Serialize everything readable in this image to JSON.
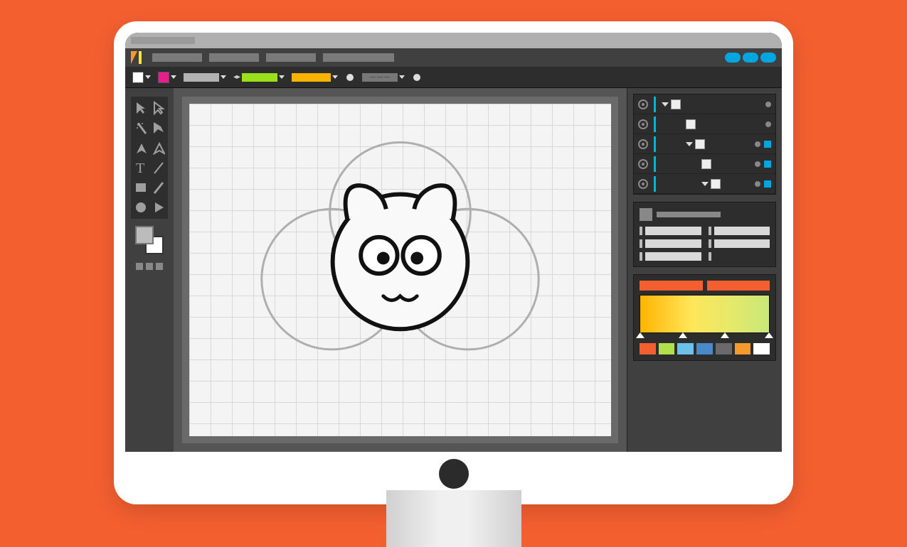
{
  "app": {
    "logo_colors": {
      "left": "#f79a2e",
      "right": "#ffe23a"
    }
  },
  "title_bar": {
    "placeholder_widths": [
      90
    ]
  },
  "menu_bar": {
    "item_widths": [
      70,
      70,
      70,
      100
    ],
    "window_button_color": "#00a6e0"
  },
  "options_bar": {
    "fill_color": "#ffffff",
    "stroke_color": "#ec1b8d",
    "stroke_weight_bar_color": "#b2b2b2",
    "swatch_a_color": "#9be01c",
    "swatch_b_color": "#f8b200"
  },
  "tools": [
    [
      "selection",
      "direct-selection"
    ],
    [
      "magic-wand",
      "lasso"
    ],
    [
      "pen",
      "curvature-pen"
    ],
    [
      "type",
      "line"
    ],
    [
      "rectangle",
      "pencil"
    ],
    [
      "ellipse",
      "play"
    ]
  ],
  "color_swatches": {
    "foreground": "#bcbcbc",
    "background": "#ffffff"
  },
  "layers": {
    "select_bar_color": "#00b7d6",
    "rows": [
      {
        "indent": 0,
        "hasTriangle": true,
        "endcap": "none"
      },
      {
        "indent": 2,
        "hasTriangle": false,
        "endcap": "none"
      },
      {
        "indent": 2,
        "hasTriangle": true,
        "endcap": "blue"
      },
      {
        "indent": 3,
        "hasTriangle": false,
        "endcap": "blue"
      },
      {
        "indent": 3,
        "hasTriangle": true,
        "endcap": "blue"
      }
    ]
  },
  "properties": {
    "field_count": 6
  },
  "color_panel": {
    "tabs_color": "#f45f30",
    "gradient_stops": [
      0,
      33,
      66,
      100
    ],
    "swatches": [
      "#f45f30",
      "#b0e04a",
      "#6cc1e8",
      "#4a88c7",
      "#6a6a6a",
      "#f79a2e",
      "#ffffff"
    ]
  },
  "canvas": {
    "artwork": "cat-face",
    "guide_circle_r": 100,
    "head_r": 96
  }
}
